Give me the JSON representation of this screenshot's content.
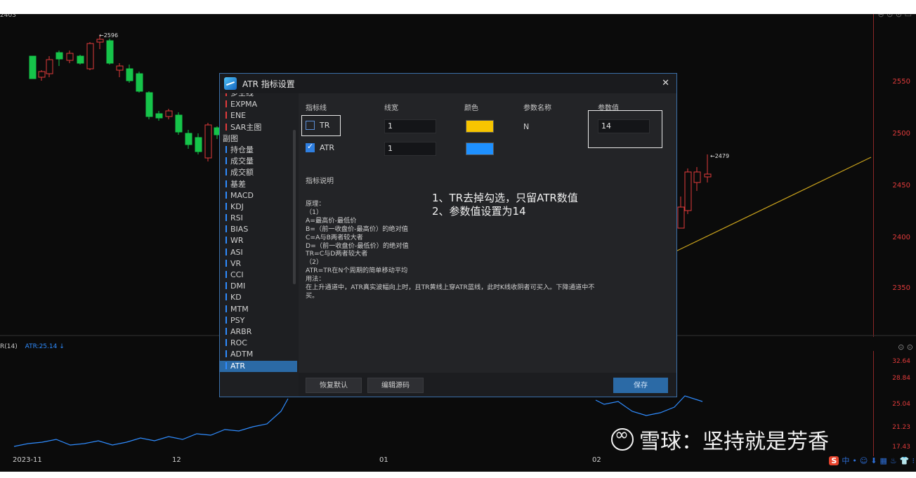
{
  "top_left_price": "2403",
  "price_axis": [
    "2550",
    "2500",
    "2450",
    "2400",
    "2350"
  ],
  "indicator_axis": [
    "32.64",
    "28.84",
    "25.04",
    "21.23",
    "17.43"
  ],
  "x_axis": [
    "2023-11",
    "12",
    "01",
    "02"
  ],
  "peaks": {
    "high": "←2596",
    "right": "←2479"
  },
  "indicator_legend": {
    "label": "R(14)",
    "atr": "ATR:25.14 ↓"
  },
  "colors": {
    "up": "#e23b3b",
    "down": "#16c44a",
    "atr_line": "#2f8cff",
    "ma_line": "#c9a21c",
    "tr_swatch": "#f7c500",
    "atr_swatch": "#1e90ff"
  },
  "dialog": {
    "title": "ATR 指标设置",
    "close": "✕",
    "list": [
      {
        "label": "多空线",
        "type": "item"
      },
      {
        "label": "EXPMA",
        "type": "item"
      },
      {
        "label": "ENE",
        "type": "item"
      },
      {
        "label": "SAR主图",
        "type": "item"
      },
      {
        "label": "副图",
        "type": "cat"
      },
      {
        "label": "持仓量",
        "type": "item"
      },
      {
        "label": "成交量",
        "type": "item"
      },
      {
        "label": "成交额",
        "type": "item"
      },
      {
        "label": "基差",
        "type": "item"
      },
      {
        "label": "MACD",
        "type": "item"
      },
      {
        "label": "KDJ",
        "type": "item"
      },
      {
        "label": "RSI",
        "type": "item"
      },
      {
        "label": "BIAS",
        "type": "item"
      },
      {
        "label": "WR",
        "type": "item"
      },
      {
        "label": "ASI",
        "type": "item"
      },
      {
        "label": "VR",
        "type": "item"
      },
      {
        "label": "CCI",
        "type": "item"
      },
      {
        "label": "DMI",
        "type": "item"
      },
      {
        "label": "KD",
        "type": "item"
      },
      {
        "label": "MTM",
        "type": "item"
      },
      {
        "label": "PSY",
        "type": "item"
      },
      {
        "label": "ARBR",
        "type": "item"
      },
      {
        "label": "ROC",
        "type": "item"
      },
      {
        "label": "ADTM",
        "type": "item"
      },
      {
        "label": "ATR",
        "type": "active"
      }
    ],
    "headers": {
      "line": "指标线",
      "width": "线宽",
      "color": "颜色",
      "param_name": "参数名称",
      "param_value": "参数值"
    },
    "rows": [
      {
        "name": "TR",
        "checked": false,
        "width": "1"
      },
      {
        "name": "ATR",
        "checked": true,
        "width": "1"
      }
    ],
    "param": {
      "name": "N",
      "value": "14"
    },
    "desc_title": "指标说明",
    "desc_lines": [
      "原理：",
      "（1）",
      "A=最高价-最低价",
      "B=（前一收盘价-最高价）的绝对值",
      "C=A与B两者较大者",
      "D=（前一收盘价-最低价）的绝对值",
      "TR=C与D两者较大者",
      "（2）",
      "ATR=TR在N个周期的简单移动平均",
      "用法：",
      "在上升通道中，ATR真实波幅向上时，且TR黄线上穿ATR蓝线，此时K线收阴者可买入。下降通道中不",
      "买。"
    ],
    "annotation": [
      "1、TR去掉勾选，只留ATR数值",
      "2、参数值设置为14"
    ],
    "buttons": {
      "reset": "恢复默认",
      "edit": "编辑源码",
      "save": "保存"
    }
  },
  "watermark": "雪球：坚持就是芳香",
  "ime": [
    "中",
    "•",
    "☺",
    "⬇",
    "▦",
    "♨",
    "👕",
    "⁝"
  ]
}
